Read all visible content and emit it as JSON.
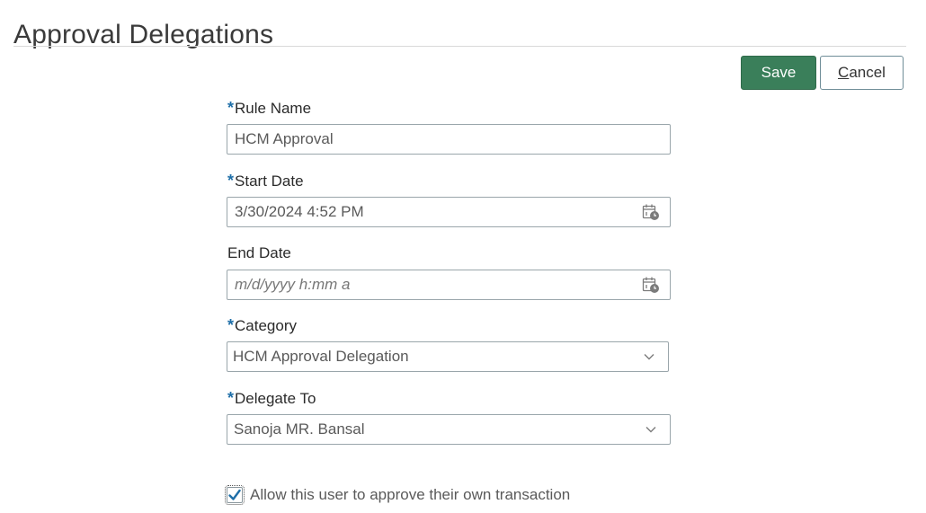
{
  "page": {
    "title": "Approval Delegations"
  },
  "toolbar": {
    "save_label": "Save",
    "cancel_label_prefix": "C",
    "cancel_label_rest": "ancel"
  },
  "form": {
    "required_marker": "*",
    "rule_name": {
      "label": "Rule Name",
      "value": "HCM Approval",
      "required": true
    },
    "start_date": {
      "label": "Start Date",
      "value": "3/30/2024 4:52 PM",
      "required": true,
      "icon": "calendar-clock-icon"
    },
    "end_date": {
      "label": "End Date",
      "value": "",
      "placeholder": "m/d/yyyy h:mm a",
      "required": false,
      "icon": "calendar-clock-icon"
    },
    "category": {
      "label": "Category",
      "value": "HCM Approval Delegation",
      "required": true,
      "icon": "chevron-down-icon"
    },
    "delegate_to": {
      "label": "Delegate To",
      "value": "Sanoja MR. Bansal",
      "required": true,
      "icon": "chevron-down-icon"
    },
    "allow_self_approve": {
      "label": "Allow this user to approve their own transaction",
      "checked": true
    }
  },
  "colors": {
    "save_button": "#3a7f5a",
    "required_marker": "#1f6fa8",
    "checkmark": "#1f6fa8"
  }
}
